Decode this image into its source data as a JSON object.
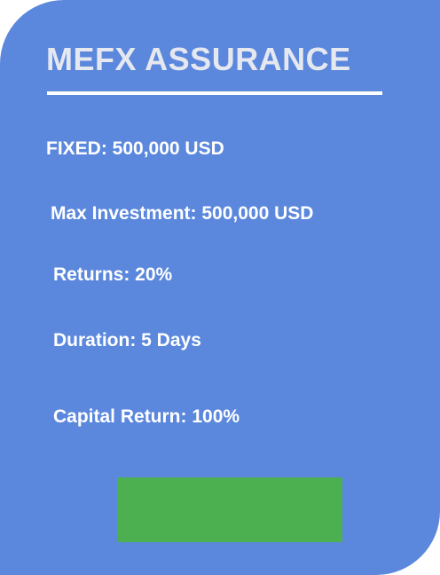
{
  "card": {
    "title": "MEFX ASSURANCE",
    "details": {
      "fixed": "FIXED: 500,000 USD",
      "max_investment": "Max Investment: 500,000 USD",
      "returns": "Returns: 20%",
      "duration": "Duration: 5 Days",
      "capital_return": "Capital Return: 100%"
    },
    "button_label": ""
  },
  "colors": {
    "card_background": "#5b88dd",
    "title_text": "#e6e8ef",
    "underline": "#ffffff",
    "button": "#4caf50"
  }
}
